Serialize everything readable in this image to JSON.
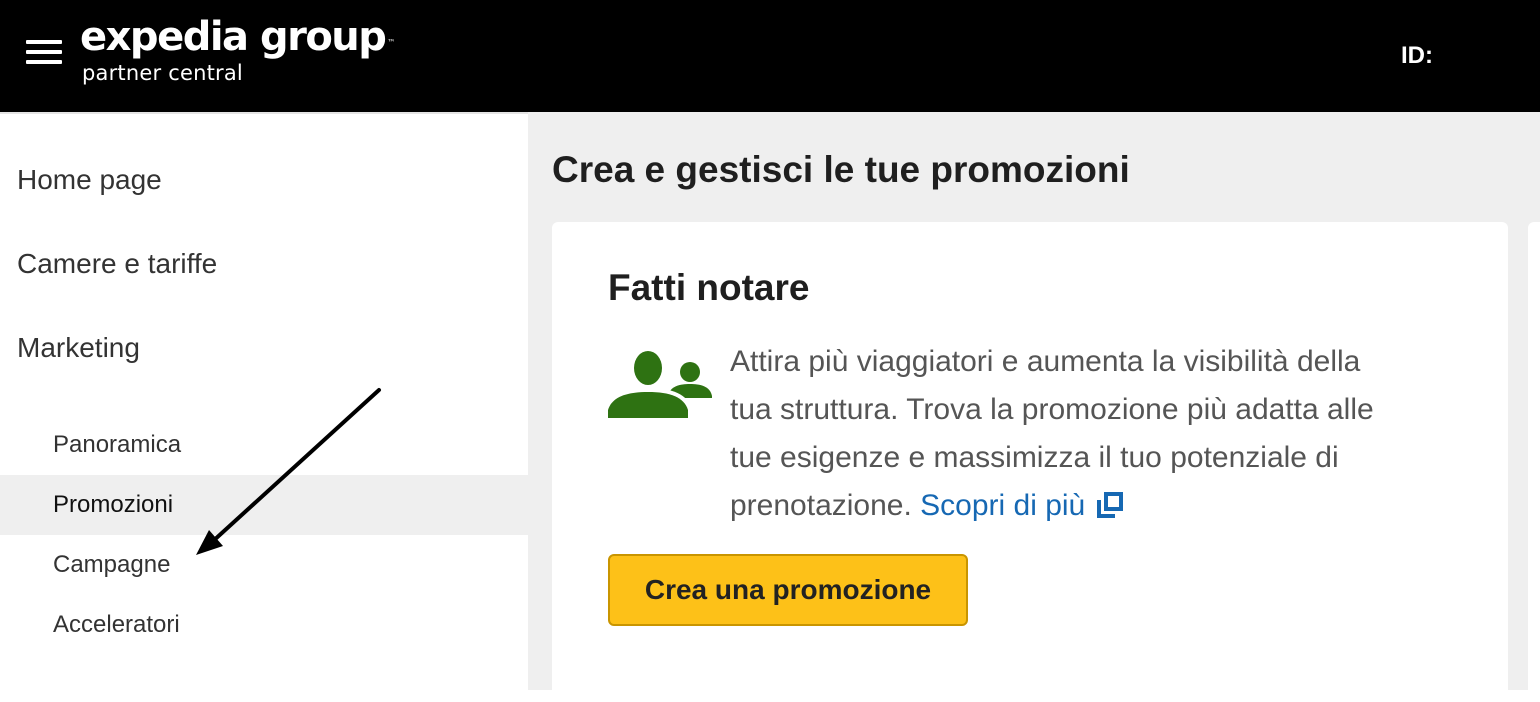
{
  "header": {
    "menu_icon": "hamburger-menu-icon",
    "logo_main": "expedia group",
    "logo_tm": "™",
    "logo_sub": "partner central",
    "account_id_label": "ID:"
  },
  "sidebar": {
    "items": [
      {
        "label": "Home page"
      },
      {
        "label": "Camere e tariffe"
      },
      {
        "label": "Marketing"
      }
    ],
    "marketing_subitems": [
      {
        "label": "Panoramica",
        "active": false
      },
      {
        "label": "Promozioni",
        "active": true
      },
      {
        "label": "Campagne",
        "active": false
      },
      {
        "label": "Acceleratori",
        "active": false
      }
    ]
  },
  "main": {
    "page_title": "Crea e gestisci le tue promozioni",
    "card": {
      "title": "Fatti notare",
      "icon": "people-icon",
      "description": "Attira più viaggiatori e aumenta la visibilità della tua struttura. Trova la promozione più adatta alle tue esigenze e massimizza il tuo potenziale di prenotazione.",
      "link_label": "Scopri di più",
      "link_icon": "external-link-icon",
      "button_label": "Crea una promozione"
    }
  },
  "colors": {
    "header_bg": "#000000",
    "page_bg": "#efefef",
    "active_nav_bg": "#efefef",
    "icon_green": "#2e7212",
    "link_blue": "#1668b3",
    "button_yellow": "#fdc118"
  }
}
